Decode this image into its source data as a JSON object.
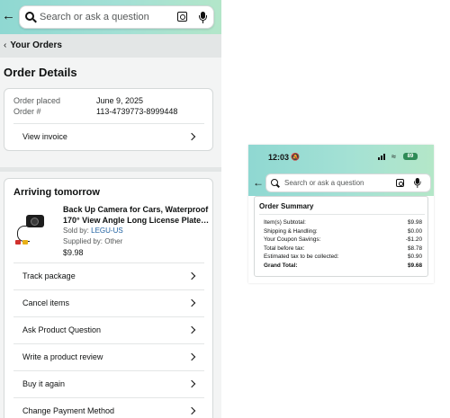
{
  "left": {
    "search": {
      "placeholder": "Search or ask a question"
    },
    "breadcrumb": "Your Orders",
    "page_title": "Order Details",
    "order": {
      "placed_label": "Order placed",
      "placed_value": "June 9, 2025",
      "number_label": "Order #",
      "number_value": "113-4739773-8999448",
      "invoice_label": "View invoice"
    },
    "arriving": {
      "title": "Arriving tomorrow",
      "product": {
        "title_line1": "Back Up Camera for Cars, Waterproof",
        "title_line2": "170° View Angle Long License Plate…",
        "sold_by_label": "Sold by:",
        "sold_by_value": "LEGU-US",
        "supplied_by": "Supplied by: Other",
        "price": "$9.98"
      },
      "actions": [
        "Track package",
        "Cancel items",
        "Ask Product Question",
        "Write a product review",
        "Buy it again",
        "Change Payment Method"
      ]
    }
  },
  "right": {
    "status": {
      "time": "12:03",
      "battery": "89"
    },
    "search": {
      "placeholder": "Search or ask a question"
    },
    "summary": {
      "title": "Order Summary",
      "rows": [
        {
          "label": "Item(s) Subtotal:",
          "value": "$9.98"
        },
        {
          "label": "Shipping & Handling:",
          "value": "$0.00"
        },
        {
          "label": "Your Coupon Savings:",
          "value": "-$1.20"
        },
        {
          "label": "Total before tax:",
          "value": "$8.78"
        },
        {
          "label": "Estimated tax to be collected:",
          "value": "$0.90"
        },
        {
          "label": "Grand Total:",
          "value": "$9.68"
        }
      ]
    }
  },
  "colors": {
    "header_gradient_start": "#8fd8d2",
    "header_gradient_end": "#b3e6c9",
    "link": "#2162a1",
    "battery": "#2e8b57"
  },
  "icons": [
    "back-arrow-icon",
    "search-icon",
    "camera-icon",
    "mic-icon",
    "chevron-right-icon",
    "bell-icon",
    "wifi-icon",
    "battery-icon"
  ]
}
